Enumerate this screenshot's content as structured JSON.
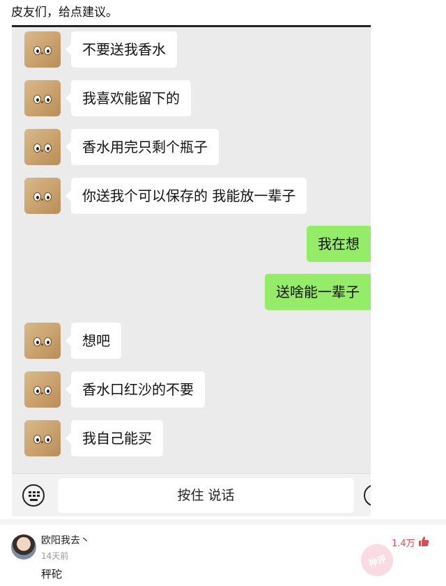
{
  "post": {
    "title": "皮友们，给点建议。"
  },
  "chat": {
    "messages": [
      {
        "side": "in",
        "text": "不要送我香水"
      },
      {
        "side": "in",
        "text": "我喜欢能留下的"
      },
      {
        "side": "in",
        "text": "香水用完只剩个瓶子"
      },
      {
        "side": "in",
        "text": "你送我个可以保存的 我能放一辈子"
      },
      {
        "side": "out",
        "text": "我在想"
      },
      {
        "side": "out",
        "text": "送啥能一辈子"
      },
      {
        "side": "in",
        "text": "想吧"
      },
      {
        "side": "in",
        "text": "香水口红沙的不要"
      },
      {
        "side": "in",
        "text": "我自己能买"
      }
    ]
  },
  "input_bar": {
    "hold_to_talk_label": "按住 说话",
    "keyboard_icon": "keyboard-icon",
    "emoji_icon": "emoji-icon"
  },
  "comment": {
    "author": "欧阳我去丶",
    "time": "14天前",
    "text": "秤砣",
    "likes": "1.4万",
    "stamp_text": "神评",
    "like_icon": "thumbs-up-icon",
    "accent_color": "#e5484d"
  }
}
